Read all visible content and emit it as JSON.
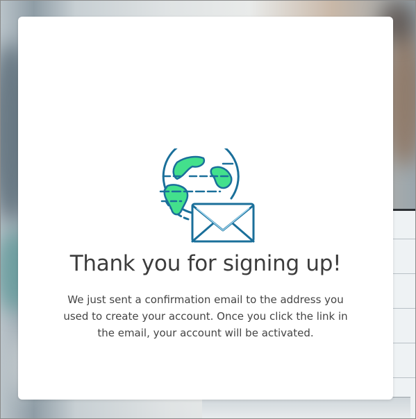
{
  "confirmation": {
    "title": "Thank you for signing up!",
    "message": "We just sent a confirmation email to the address you used to create your account. Once you click the link in the email, your account will be activated."
  },
  "illustration": {
    "icons": [
      "globe-icon",
      "envelope-icon"
    ],
    "colors": {
      "outline": "#1a6f9a",
      "land": "#43e08c",
      "envelope_fill": "#ffffff"
    }
  }
}
